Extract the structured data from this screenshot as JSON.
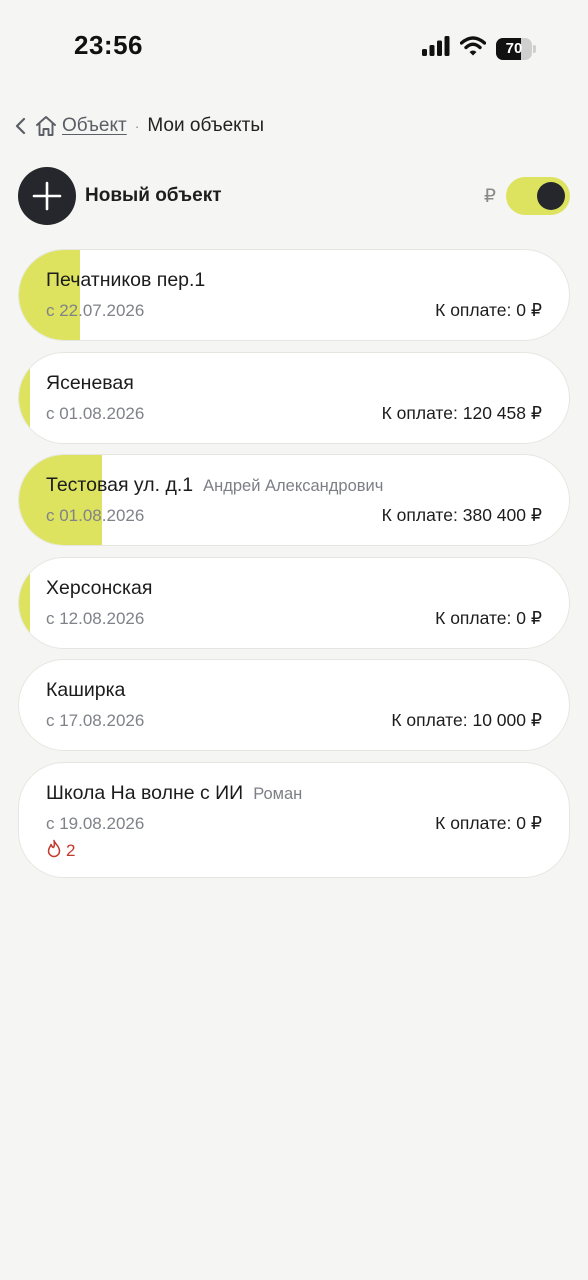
{
  "status_bar": {
    "time": "23:56",
    "battery_level": 70,
    "battery_text": "70"
  },
  "breadcrumb": {
    "parent_label": "Объект",
    "separator": "·",
    "current_label": "Мои объекты"
  },
  "toolbar": {
    "new_object_label": "Новый объект",
    "currency_symbol": "₽",
    "currency_toggle_on": true
  },
  "colors": {
    "accent": "#dde35f",
    "dark": "#25272c",
    "alert": "#c1392b"
  },
  "objects": [
    {
      "title": "Печатников пер.1",
      "owner": "",
      "date": "с 22.07.2026",
      "payment_label": "К оплате:",
      "payment_value": "0 ₽",
      "progress": 0.11,
      "alert_count": ""
    },
    {
      "title": "Ясеневая",
      "owner": "",
      "date": "с 01.08.2026",
      "payment_label": "К оплате:",
      "payment_value": "120 458 ₽",
      "progress": 0.02,
      "alert_count": ""
    },
    {
      "title": "Тестовая ул. д.1",
      "owner": "Андрей Александрович",
      "date": "с 01.08.2026",
      "payment_label": "К оплате:",
      "payment_value": "380 400 ₽",
      "progress": 0.15,
      "alert_count": ""
    },
    {
      "title": "Херсонская",
      "owner": "",
      "date": "с 12.08.2026",
      "payment_label": "К оплате:",
      "payment_value": "0 ₽",
      "progress": 0.02,
      "alert_count": ""
    },
    {
      "title": "Каширка",
      "owner": "",
      "date": "с 17.08.2026",
      "payment_label": "К оплате:",
      "payment_value": "10 000 ₽",
      "progress": 0,
      "alert_count": ""
    },
    {
      "title": "Школа На волне с ИИ",
      "owner": "Роман",
      "date": "с 19.08.2026",
      "payment_label": "К оплате:",
      "payment_value": "0 ₽",
      "progress": 0,
      "alert_count": "2"
    }
  ]
}
